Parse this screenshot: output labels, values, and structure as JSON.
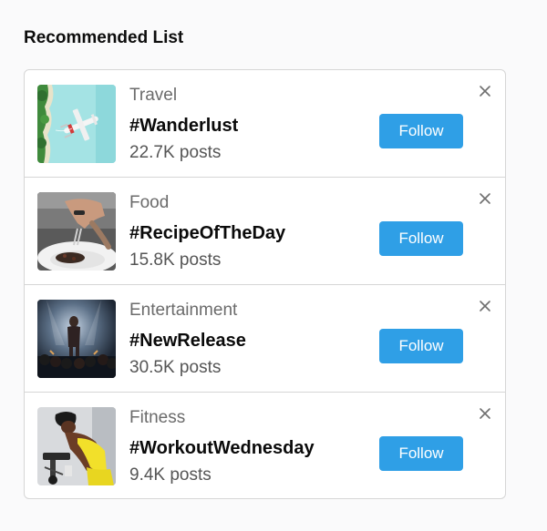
{
  "list_title": "Recommended List",
  "items": [
    {
      "category": "Travel",
      "hashtag": "#Wanderlust",
      "posts": "22.7K posts",
      "follow_label": "Follow",
      "image": "seaplane-on-turquoise-water"
    },
    {
      "category": "Food",
      "hashtag": "#RecipeOfTheDay",
      "posts": "15.8K posts",
      "follow_label": "Follow",
      "image": "chef-plating-dish"
    },
    {
      "category": "Entertainment",
      "hashtag": "#NewRelease",
      "posts": "30.5K posts",
      "follow_label": "Follow",
      "image": "performer-on-stage"
    },
    {
      "category": "Fitness",
      "hashtag": "#WorkoutWednesday",
      "posts": "9.4K posts",
      "follow_label": "Follow",
      "image": "athlete-training-on-bike"
    }
  ],
  "colors": {
    "follow_button": "#2f9fe6",
    "border": "#d6d6d6",
    "background": "#fafafb"
  },
  "icons": {
    "dismiss": "close-icon"
  }
}
